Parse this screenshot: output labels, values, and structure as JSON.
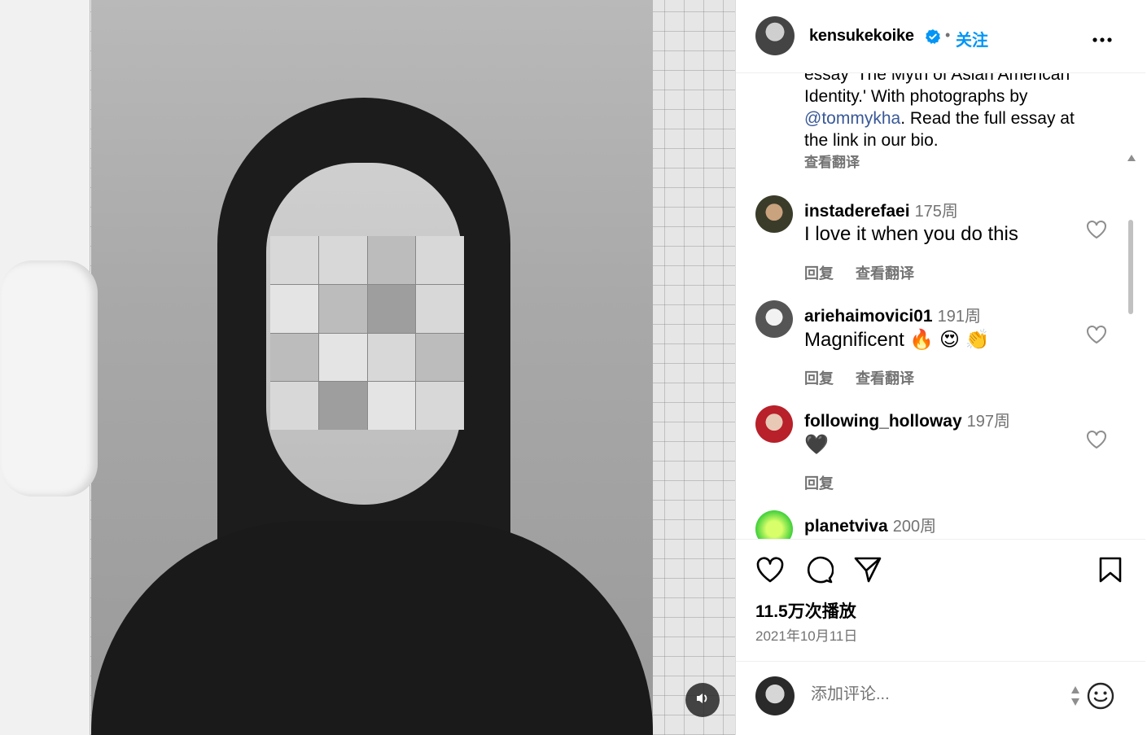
{
  "post": {
    "username": "kensukekoike",
    "follow_label": "关注",
    "separator": "•",
    "caption_line1": "essay 'The Myth of Asian American",
    "caption_line2": "Identity.' With photographs by",
    "caption_mention": "@tommykha",
    "caption_line3_rest": ". Read the full essay at",
    "caption_line4": "the link in our bio.",
    "see_translation": "查看翻译",
    "views": "11.5万次播放",
    "date": "2021年10月11日"
  },
  "comments": [
    {
      "user": "instaderefaei",
      "time": "175周",
      "text": "I love it when you do this",
      "reply": "回复",
      "translate": "查看翻译"
    },
    {
      "user": "ariehaimovici01",
      "time": "191周",
      "text": "Magnificent 🔥 😍 👏",
      "reply": "回复",
      "translate": "查看翻译"
    },
    {
      "user": "following_holloway",
      "time": "197周",
      "text": "🖤",
      "reply": "回复",
      "translate": ""
    },
    {
      "user": "planetviva",
      "time": "200周",
      "text": "",
      "reply": "",
      "translate": ""
    }
  ],
  "comment_box": {
    "placeholder": "添加评论..."
  },
  "colors": {
    "accent": "#0095f6",
    "secondary_text": "#737373",
    "mention": "#385898"
  },
  "icons": [
    "verified-icon",
    "more-icon",
    "heart-icon",
    "comment-icon",
    "share-icon",
    "bookmark-icon",
    "mute-icon",
    "emoji-icon"
  ]
}
